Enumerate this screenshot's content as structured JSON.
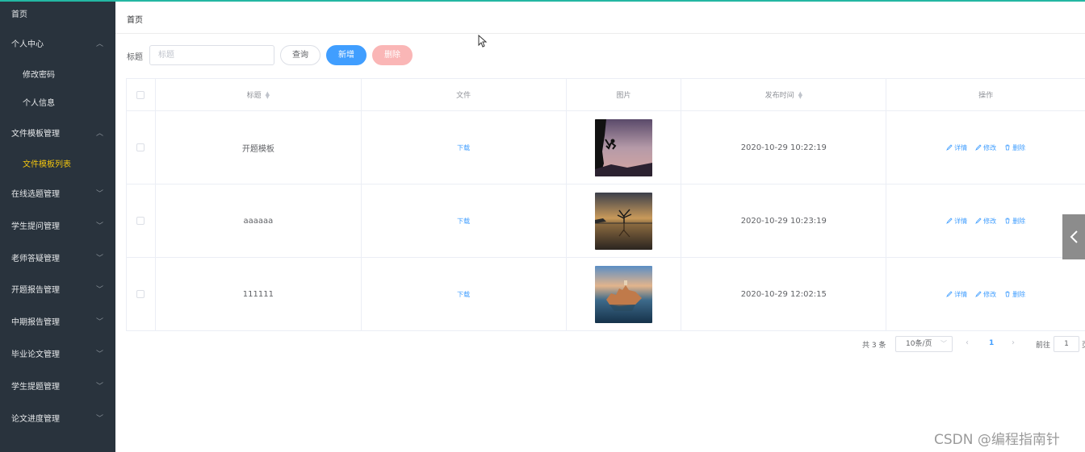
{
  "sidebar": {
    "items": [
      {
        "label": "首页",
        "chevron": "",
        "type": "top"
      },
      {
        "label": "个人中心",
        "chevron": "up",
        "type": "group"
      },
      {
        "label": "修改密码",
        "chevron": "",
        "type": "sub"
      },
      {
        "label": "个人信息",
        "chevron": "",
        "type": "sub"
      },
      {
        "label": "文件模板管理",
        "chevron": "up",
        "type": "group"
      },
      {
        "label": "文件模板列表",
        "chevron": "",
        "type": "sub-active"
      },
      {
        "label": "在线选题管理",
        "chevron": "down",
        "type": "group"
      },
      {
        "label": "学生提问管理",
        "chevron": "down",
        "type": "group"
      },
      {
        "label": "老师答疑管理",
        "chevron": "down",
        "type": "group"
      },
      {
        "label": "开题报告管理",
        "chevron": "down",
        "type": "group"
      },
      {
        "label": "中期报告管理",
        "chevron": "down",
        "type": "group"
      },
      {
        "label": "毕业论文管理",
        "chevron": "down",
        "type": "group"
      },
      {
        "label": "学生提题管理",
        "chevron": "down",
        "type": "group"
      },
      {
        "label": "论文进度管理",
        "chevron": "down",
        "type": "group"
      }
    ],
    "bg_color": "#29333d",
    "active_color": "#f1c40f"
  },
  "breadcrumb": {
    "label": "首页"
  },
  "search": {
    "label": "标题",
    "placeholder": "标题",
    "value": ""
  },
  "buttons": {
    "query": "查询",
    "add": "新增",
    "delete": "删除"
  },
  "table": {
    "headers": {
      "title": "标题",
      "file": "文件",
      "image": "图片",
      "publish_time": "发布时间",
      "actions": "操作"
    },
    "rows": [
      {
        "title": "开题模板",
        "file": "下载",
        "image": "climber-silhouette",
        "publish_time": "2020-10-29 10:22:19"
      },
      {
        "title": "aaaaaa",
        "file": "下载",
        "image": "lake-tree-sunset",
        "publish_time": "2020-10-29 10:23:19"
      },
      {
        "title": "111111",
        "file": "下载",
        "image": "island-castle",
        "publish_time": "2020-10-29 12:02:15"
      }
    ],
    "row_actions": {
      "detail": "详情",
      "edit": "修改",
      "delete": "删除"
    }
  },
  "pagination": {
    "total": "共 3 条",
    "page_size": "10条/页",
    "current_page": "1",
    "goto_label": "前往",
    "goto_value": "1",
    "goto_suffix": "页"
  },
  "accent_color": "#409eff",
  "watermark": "CSDN @编程指南针"
}
